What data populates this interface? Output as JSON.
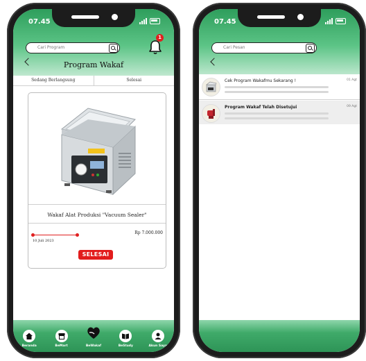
{
  "left": {
    "time": "07.45",
    "search_placeholder": "Cari Program",
    "badge_count": "1",
    "page_title": "Program Wakaf",
    "tabs": [
      "Sedang Berlangsung",
      "Selesai"
    ],
    "card": {
      "title": "Wakaf Alat Produksi \"Vacuum Sealer\"",
      "price": "Rp 7.000.000",
      "date": "10 Juli 2023",
      "status": "SELESAI",
      "progress": 1.0
    },
    "nav": [
      {
        "label": "Beranda",
        "icon": "home-icon"
      },
      {
        "label": "BeMart",
        "icon": "store-icon"
      },
      {
        "label": "BeWakaf",
        "icon": "heart-hand-icon"
      },
      {
        "label": "BeStudy",
        "icon": "book-icon"
      },
      {
        "label": "Akun Saya",
        "icon": "user-icon"
      }
    ]
  },
  "right": {
    "time": "07.45",
    "search_placeholder": "Cari Pesan",
    "notifications": [
      {
        "title": "Cek Program Wakafmu Sekarang !",
        "date": "01 Agt"
      },
      {
        "title": "Program Wakaf Telah Disetujui",
        "date": "09 Agt"
      }
    ]
  },
  "colors": {
    "accent": "#3faa69",
    "danger": "#e21c1c"
  }
}
